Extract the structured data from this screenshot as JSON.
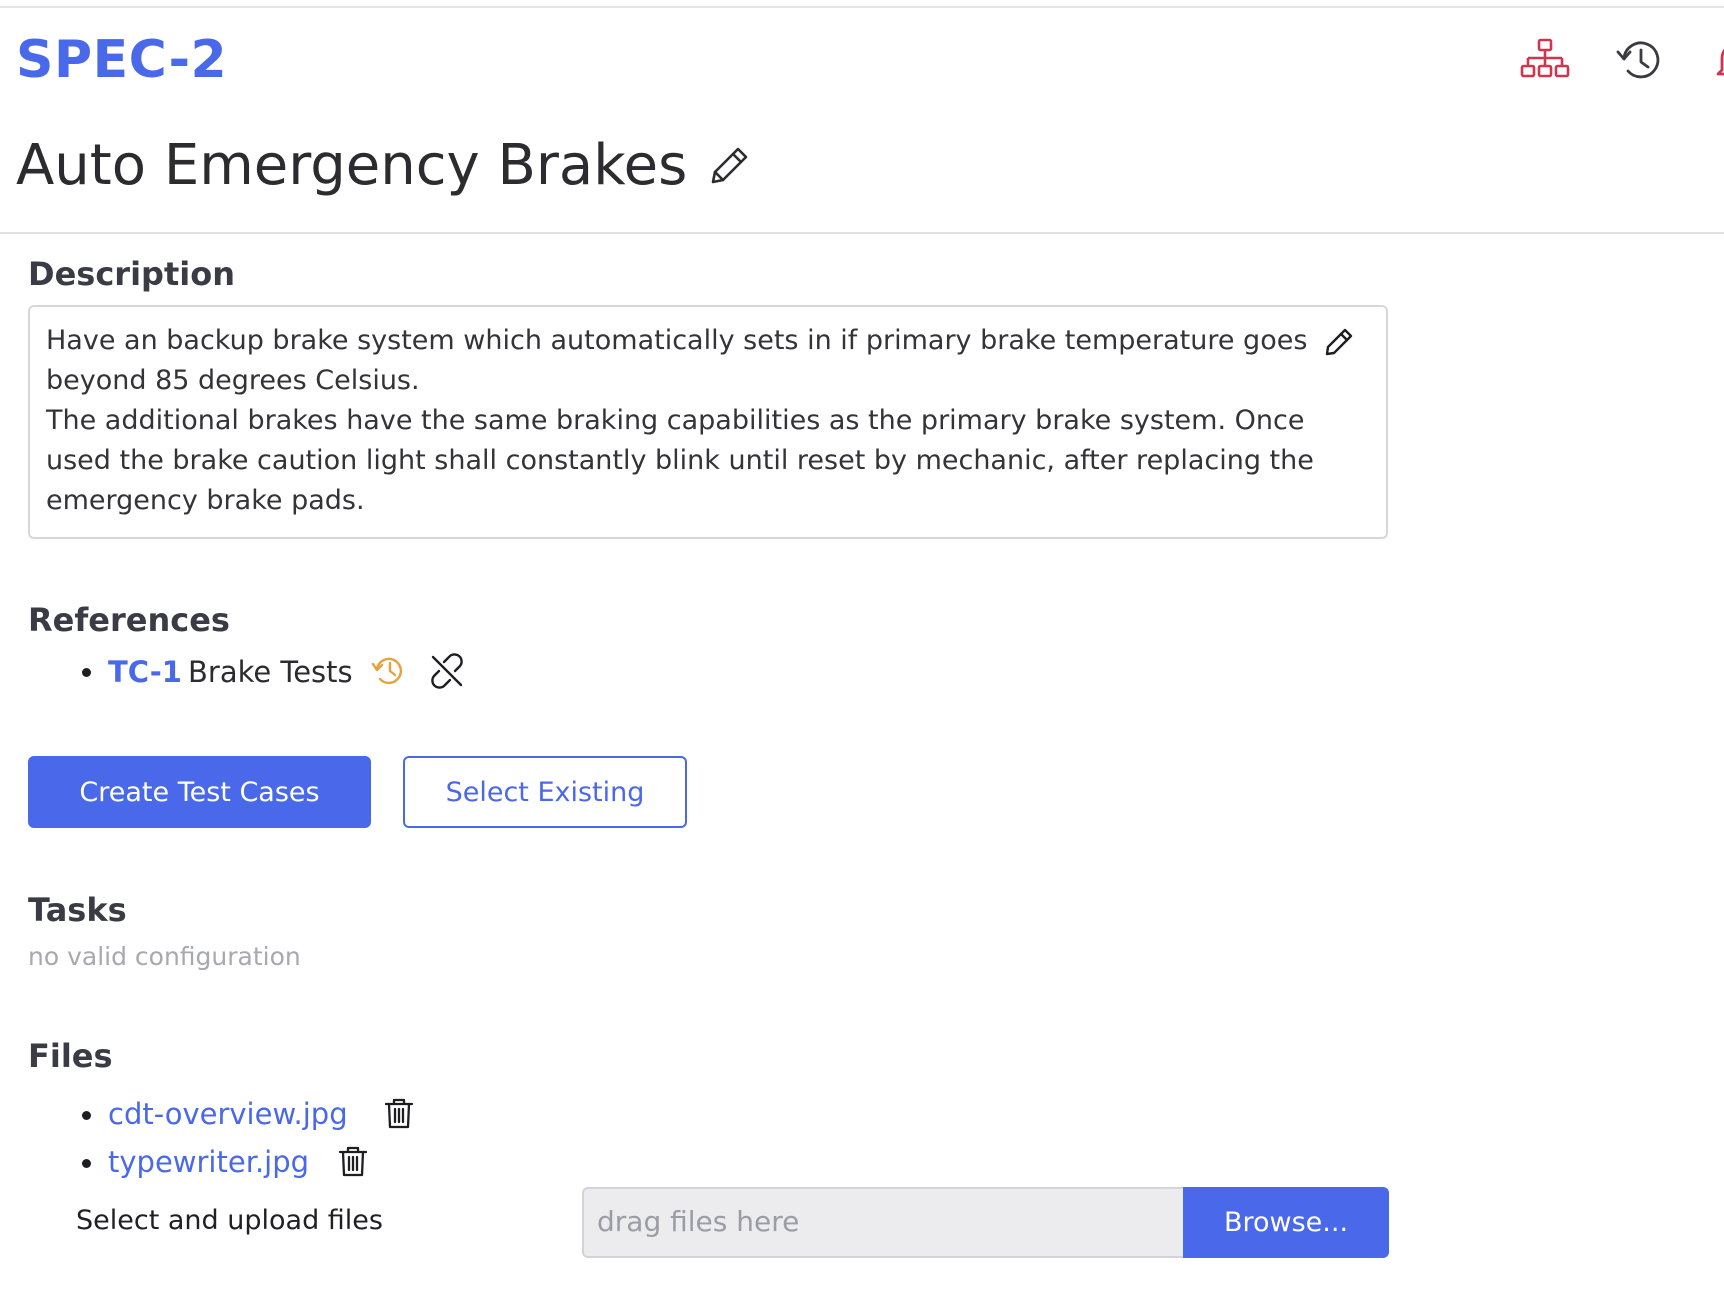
{
  "header": {
    "spec_id": "SPEC-2",
    "title": "Auto Emergency Brakes",
    "icons": [
      "hierarchy-icon",
      "history-icon",
      "bell-icon"
    ]
  },
  "description": {
    "label": "Description",
    "text": "Have an backup brake system which automatically sets in if primary brake temperature goes\nbeyond 85 degrees Celsius.\nThe additional brakes have the same braking capabilities as the primary brake system. Once\nused the brake caution light shall constantly blink until reset by mechanic, after replacing the\nemergency brake pads."
  },
  "references": {
    "label": "References",
    "items": [
      {
        "id": "TC-1",
        "name": "Brake Tests",
        "icons": [
          "history-icon",
          "unlink-icon"
        ]
      }
    ]
  },
  "actions": {
    "create_label": "Create Test Cases",
    "select_label": "Select Existing"
  },
  "tasks": {
    "label": "Tasks",
    "empty_text": "no valid configuration"
  },
  "files": {
    "label": "Files",
    "items": [
      {
        "name": "cdt-overview.jpg"
      },
      {
        "name": "typewriter.jpg"
      }
    ],
    "upload_label": "Select and upload files",
    "drop_placeholder": "drag files here",
    "browse_label": "Browse..."
  },
  "colors": {
    "accent": "#4a68ea",
    "hierarchy_icon": "#d1344f",
    "history_ref_icon": "#e6a23c",
    "muted_text": "#a8a8b0"
  }
}
